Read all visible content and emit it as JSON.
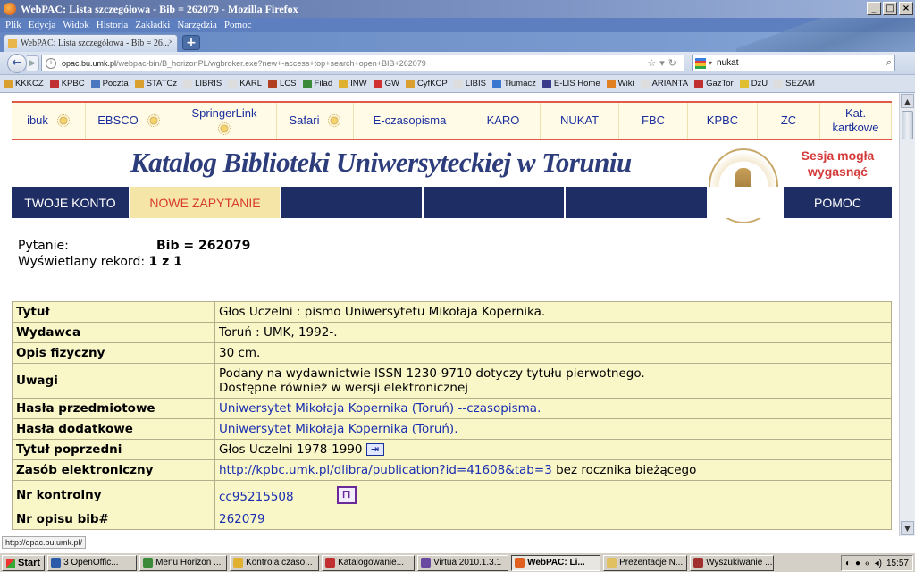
{
  "window": {
    "title": "WebPAC: Lista szczegółowa - Bib = 262079 - Mozilla Firefox"
  },
  "menu": [
    "Plik",
    "Edycja",
    "Widok",
    "Historia",
    "Zakładki",
    "Narzędzia",
    "Pomoc"
  ],
  "tab": {
    "label": "WebPAC: Lista szczegółowa - Bib = 26...",
    "new_tab": "+"
  },
  "nav": {
    "url_host": "opac.bu.umk.pl",
    "url_path": "/webpac-bin/B_horizonPL/wgbroker.exe?new+-access+top+search+open+BIB+262079",
    "search_value": "nukat"
  },
  "bookmarks": [
    {
      "label": "KKKCZ",
      "color": "#d9a030"
    },
    {
      "label": "KPBC",
      "color": "#c03030"
    },
    {
      "label": "Poczta",
      "color": "#4a78c0"
    },
    {
      "label": "STATCz",
      "color": "#d9a030"
    },
    {
      "label": "LIBRIS",
      "color": "#dddddd"
    },
    {
      "label": "KARL",
      "color": "#dddddd"
    },
    {
      "label": "LCS",
      "color": "#b04020"
    },
    {
      "label": "Filad",
      "color": "#3a8a3a"
    },
    {
      "label": "INW",
      "color": "#e0b030"
    },
    {
      "label": "GW",
      "color": "#d03030"
    },
    {
      "label": "CyfKCP",
      "color": "#d9a030"
    },
    {
      "label": "LIBIS",
      "color": "#dddddd"
    },
    {
      "label": "Tłumacz",
      "color": "#3a78d0"
    },
    {
      "label": "E-LIS Home",
      "color": "#3a3a8a"
    },
    {
      "label": "Wiki",
      "color": "#e08020"
    },
    {
      "label": "ARIANTA",
      "color": "#dddddd"
    },
    {
      "label": "GazTor",
      "color": "#c03030"
    },
    {
      "label": "DzU",
      "color": "#e0c030"
    },
    {
      "label": "SEZAM",
      "color": "#dddddd"
    }
  ],
  "toplinks": [
    "ibuk",
    "EBSCO",
    "SpringerLink",
    "Safari",
    "E-czasopisma",
    "KARO",
    "NUKAT",
    "FBC",
    "KPBC",
    "ZC",
    "Kat. kartkowe"
  ],
  "header": {
    "logo": "Katalog Biblioteki Uniwersyteckiej w Toruniu",
    "session": "Sesja mogła wygasnąć"
  },
  "mainnav": {
    "account": "TWOJE KONTO",
    "new_query": "NOWE ZAPYTANIE",
    "help": "POMOC"
  },
  "query": {
    "question_label": "Pytanie:",
    "question_value": "Bib = 262079",
    "record_label": "Wyświetlany rekord:",
    "record_value": "1 z 1"
  },
  "record": {
    "title": {
      "k": "Tytuł",
      "v": "Głos Uczelni : pismo Uniwersytetu Mikołaja Kopernika."
    },
    "publisher": {
      "k": "Wydawca",
      "v": "Toruń : UMK, 1992-."
    },
    "physical": {
      "k": "Opis fizyczny",
      "v": "30 cm."
    },
    "notes": {
      "k": "Uwagi",
      "v1": "Podany na wydawnictwie ISSN 1230-9710 dotyczy tytułu pierwotnego.",
      "v2": "Dostępne również w wersji elektronicznej"
    },
    "subject": {
      "k": "Hasła przedmiotowe",
      "v": "Uniwersytet Mikołaja Kopernika (Toruń) --czasopisma."
    },
    "added": {
      "k": "Hasła dodatkowe",
      "v": "Uniwersytet Mikołaja Kopernika (Toruń)."
    },
    "previous": {
      "k": "Tytuł poprzedni",
      "v": "Głos Uczelni 1978-1990"
    },
    "eresource": {
      "k": "Zasób elektroniczny",
      "link": "http://kpbc.umk.pl/dlibra/publication?id=41608&tab=3",
      "suffix": " bez rocznika bieżącego"
    },
    "control": {
      "k": "Nr kontrolny",
      "v": "cc95215508"
    },
    "bib": {
      "k": "Nr opisu bib#",
      "v": "262079"
    }
  },
  "statustip": "http://opac.bu.umk.pl/",
  "taskbar": {
    "start": "Start",
    "tasks": [
      {
        "label": "3 OpenOffic...",
        "color": "#2a5aa8"
      },
      {
        "label": "Menu Horizon ...",
        "color": "#3a8a3a"
      },
      {
        "label": "Kontrola czaso...",
        "color": "#e0b030"
      },
      {
        "label": "Katalogowanie...",
        "color": "#c03030"
      },
      {
        "label": "Virtua 2010.1.3.1",
        "color": "#6a4aa0"
      },
      {
        "label": "WebPAC: Li...",
        "color": "#e06020"
      },
      {
        "label": "Prezentacje N...",
        "color": "#e0c060"
      },
      {
        "label": "Wyszukiwanie ...",
        "color": "#a03030"
      }
    ],
    "clock": "15:57"
  }
}
